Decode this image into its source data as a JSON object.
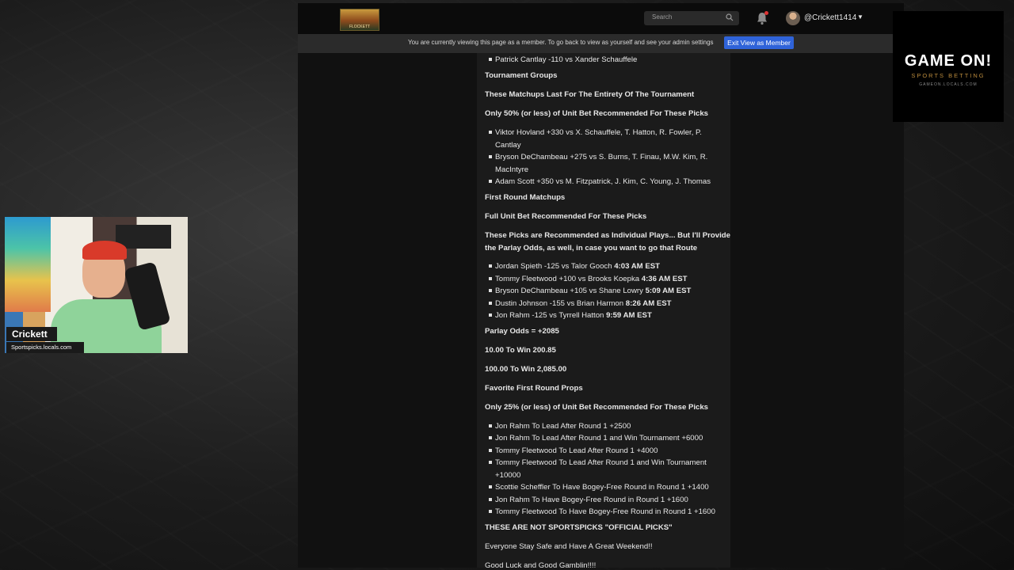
{
  "topbar": {
    "logo_text": "FLOCKETT",
    "search_placeholder": "Search",
    "username": "@Crickett1414"
  },
  "notice": {
    "text": "You are currently viewing this page as a member. To go back to view as yourself and see your admin settings",
    "button": "Exit View as Member"
  },
  "post": {
    "top_item": "Patrick Cantlay -110 vs Xander Schauffele",
    "h_groups": "Tournament Groups",
    "h_matchups_last": "These Matchups Last For The Entirety Of The Tournament",
    "h_fifty": "Only 50% (or less) of Unit Bet Recommended For These Picks",
    "group_items": [
      [
        "Viktor Hovland +330 vs X. Schauffele, T. Hatton, R. Fowler, P.",
        "Cantlay"
      ],
      [
        "Bryson DeChambeau +275 vs S. Burns, T. Finau, M.W. Kim, R.",
        "MacIntyre"
      ],
      [
        "Adam Scott +350 vs M. Fitzpatrick, J. Kim, C. Young, J. Thomas"
      ]
    ],
    "h_first_round": "First Round Matchups",
    "h_full_unit": "Full Unit Bet Recommended For These Picks",
    "h_individual_1": "These Picks are Recommended as Individual Plays... But I'll Provide",
    "h_individual_2": "the Parlay Odds, as well, in case you want to go that Route",
    "matchups": [
      {
        "text": "Jordan Spieth -125 vs Talor Gooch ",
        "time": "4:03 AM EST"
      },
      {
        "text": "Tommy Fleetwood +100 vs Brooks Koepka ",
        "time": "4:36 AM EST"
      },
      {
        "text": "Bryson DeChambeau +105 vs Shane Lowry ",
        "time": "5:09 AM EST"
      },
      {
        "text": "Dustin Johnson -155 vs Brian Harmon ",
        "time": "8:26 AM EST"
      },
      {
        "text": "Jon Rahm -125 vs Tyrrell Hatton ",
        "time": "9:59 AM EST"
      }
    ],
    "parlay_odds": "Parlay Odds = +2085",
    "win_1": "10.00 To Win 200.85",
    "win_2": "100.00 To Win 2,085.00",
    "h_props": "Favorite First Round Props",
    "h_twentyfive": "Only 25% (or less) of Unit Bet Recommended For These Picks",
    "props": [
      [
        "Jon Rahm To Lead After Round 1 +2500"
      ],
      [
        "Jon Rahm To Lead After Round 1 and Win Tournament +6000"
      ],
      [
        "Tommy Fleetwood To Lead After Round 1 +4000"
      ],
      [
        "Tommy Fleetwood To Lead After Round 1 and Win Tournament",
        "+10000"
      ],
      [
        "Scottie Scheffler To Have Bogey-Free Round in Round 1 +1400"
      ],
      [
        "Jon Rahm To Have Bogey-Free Round in Round 1 +1600"
      ],
      [
        "Tommy Fleetwood To Have Bogey-Free Round in Round 1 +1600"
      ]
    ],
    "h_not_official": "THESE ARE NOT SPORTSPICKS \"OFFICIAL PICKS\"",
    "stay_safe": "Everyone Stay Safe and Have A Great Weekend!!",
    "good_luck": "Good Luck and Good Gamblin!!!!"
  },
  "webcam": {
    "name": "Crickett",
    "url": "Sportspicks.locals.com"
  },
  "gameon": {
    "title": "GAME ON!",
    "subtitle": "SPORTS BETTING",
    "url": "GAMEON.LOCALS.COM"
  },
  "colors": {
    "accent_button": "#2f63d9",
    "notification_dot": "#dd3333",
    "brand_gold": "#b98a3c"
  }
}
